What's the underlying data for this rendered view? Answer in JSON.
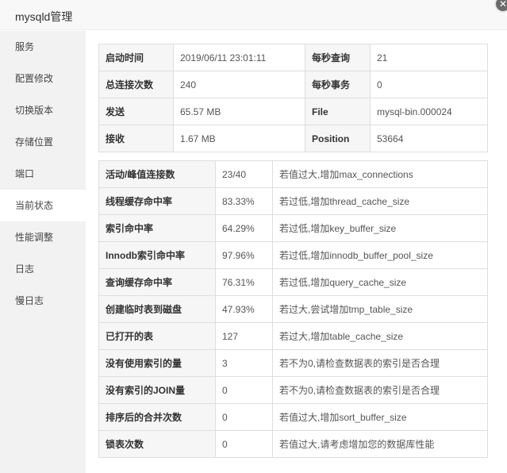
{
  "window": {
    "title": "mysqld管理",
    "close_glyph": "✕"
  },
  "sidebar": {
    "items": [
      {
        "label": "服务"
      },
      {
        "label": "配置修改"
      },
      {
        "label": "切换版本"
      },
      {
        "label": "存储位置"
      },
      {
        "label": "端口"
      },
      {
        "label": "当前状态",
        "active": true
      },
      {
        "label": "性能调整"
      },
      {
        "label": "日志"
      },
      {
        "label": "慢日志"
      }
    ]
  },
  "info": {
    "rows": [
      {
        "k1": "启动时间",
        "v1": "2019/06/11 23:01:11",
        "k2": "每秒查询",
        "v2": "21"
      },
      {
        "k1": "总连接次数",
        "v1": "240",
        "k2": "每秒事务",
        "v2": "0"
      },
      {
        "k1": "发送",
        "v1": "65.57 MB",
        "k2": "File",
        "v2": "mysql-bin.000024"
      },
      {
        "k1": "接收",
        "v1": "1.67 MB",
        "k2": "Position",
        "v2": "53664"
      }
    ]
  },
  "stats": {
    "rows": [
      {
        "name": "活动/峰值连接数",
        "value": "23/40",
        "advice": "若值过大,增加max_connections"
      },
      {
        "name": "线程缓存命中率",
        "value": "83.33%",
        "advice": "若过低,增加thread_cache_size"
      },
      {
        "name": "索引命中率",
        "value": "64.29%",
        "advice": "若过低,增加key_buffer_size"
      },
      {
        "name": "Innodb索引命中率",
        "value": "97.96%",
        "advice": "若过低,增加innodb_buffer_pool_size"
      },
      {
        "name": "查询缓存命中率",
        "value": "76.31%",
        "advice": "若过低,增加query_cache_size"
      },
      {
        "name": "创建临时表到磁盘",
        "value": "47.93%",
        "advice": "若过大,尝试增加tmp_table_size"
      },
      {
        "name": "已打开的表",
        "value": "127",
        "advice": "若过大,增加table_cache_size"
      },
      {
        "name": "没有使用索引的量",
        "value": "3",
        "advice": "若不为0,请检查数据表的索引是否合理"
      },
      {
        "name": "没有索引的JOIN量",
        "value": "0",
        "advice": "若不为0,请检查数据表的索引是否合理"
      },
      {
        "name": "排序后的合并次数",
        "value": "0",
        "advice": "若值过大,增加sort_buffer_size"
      },
      {
        "name": "锁表次数",
        "value": "0",
        "advice": "若值过大,请考虑增加您的数据库性能"
      }
    ]
  }
}
